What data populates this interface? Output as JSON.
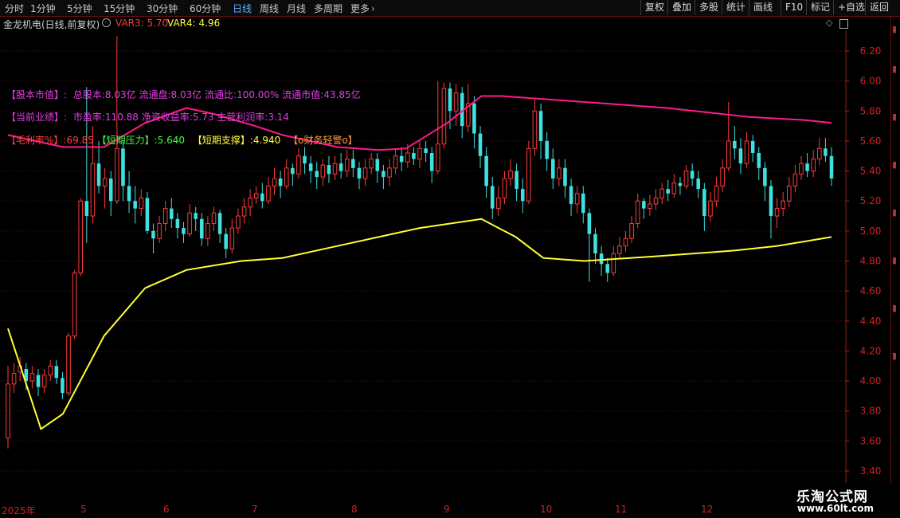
{
  "toolbar": {
    "periods": [
      "分时",
      "1分钟",
      "5分钟",
      "15分钟",
      "30分钟",
      "60分钟",
      "日线",
      "周线",
      "月线",
      "多周期",
      "更多"
    ],
    "active_period": "日线",
    "tools": [
      "复权",
      "叠加",
      "多股",
      "统计",
      "画线",
      "F10",
      "标记",
      "+自选",
      "返回"
    ]
  },
  "stock": {
    "title": "金龙机电(日线,前复权)",
    "var3": "VAR3: 5.70",
    "var4": "VAR4: 4.96"
  },
  "overlay": {
    "line1_label": "【股本市值】:",
    "line1_text": "总股本:8.03亿 流通盘:8.03亿 流通比:100.00% 流通市值:43.85亿",
    "line2_label": "【当前业绩】:",
    "line2_text": "市盈率:110.88 净资收益率:5.73 主营利润率:3.14",
    "line3_a": "【毛利率%】:69.85",
    "line3_b": "【短期压力】:5.640",
    "line3_c": "【短期支撑】:4.940",
    "line3_d": "【o财务轻警o】"
  },
  "price_axis": {
    "ticks": [
      "6.20",
      "6.00",
      "5.80",
      "5.60",
      "5.40",
      "5.20",
      "5.00",
      "4.80",
      "4.60",
      "4.40",
      "4.20",
      "4.00",
      "3.80",
      "3.60",
      "3.40"
    ]
  },
  "date_axis": {
    "labels": [
      "2025年",
      "5",
      "6",
      "7",
      "8",
      "9",
      "10",
      "11",
      "12"
    ]
  },
  "watermark": {
    "line1": "乐淘公式网",
    "line2": "www.60lt.com"
  },
  "colors": {
    "up": "#ff3b3b",
    "down": "#3fe0e0",
    "ma_long": "#ffff33",
    "ma_upper": "#ff1a8c",
    "grid": "#6e1010",
    "label_magenta": "#e040e0",
    "label_red": "#ff4040",
    "label_green": "#40ff40",
    "label_yellow": "#ffff40"
  },
  "chart_data": {
    "type": "candlestick",
    "ylim": [
      3.3,
      6.4
    ],
    "candles": [
      [
        3.62,
        3.98,
        3.55,
        4.1
      ],
      [
        3.98,
        4.05,
        3.92,
        4.12
      ],
      [
        4.06,
        4.1,
        4.0,
        4.16
      ],
      [
        4.08,
        4.0,
        3.94,
        4.12
      ],
      [
        4.0,
        4.05,
        3.95,
        4.1
      ],
      [
        4.04,
        3.96,
        3.9,
        4.08
      ],
      [
        3.96,
        4.04,
        3.92,
        4.08
      ],
      [
        4.04,
        4.1,
        4.0,
        4.14
      ],
      [
        4.1,
        4.02,
        3.98,
        4.14
      ],
      [
        4.02,
        3.92,
        3.88,
        4.06
      ],
      [
        3.92,
        4.3,
        3.9,
        4.32
      ],
      [
        4.3,
        4.72,
        4.28,
        4.74
      ],
      [
        4.72,
        5.2,
        4.7,
        5.22
      ],
      [
        5.2,
        5.1,
        4.92,
        5.96
      ],
      [
        5.1,
        5.45,
        5.05,
        5.7
      ],
      [
        5.45,
        5.3,
        5.25,
        5.6
      ],
      [
        5.3,
        5.35,
        5.15,
        5.42
      ],
      [
        5.35,
        5.2,
        5.1,
        5.4
      ],
      [
        5.2,
        5.55,
        5.18,
        6.3
      ],
      [
        5.55,
        5.3,
        5.2,
        5.6
      ],
      [
        5.3,
        5.2,
        5.12,
        5.4
      ],
      [
        5.2,
        5.15,
        5.05,
        5.3
      ],
      [
        5.15,
        5.22,
        5.1,
        5.28
      ],
      [
        5.22,
        5.0,
        4.98,
        5.26
      ],
      [
        5.0,
        4.95,
        4.85,
        5.05
      ],
      [
        4.95,
        5.05,
        4.92,
        5.1
      ],
      [
        5.05,
        5.15,
        5.0,
        5.2
      ],
      [
        5.15,
        5.08,
        5.02,
        5.22
      ],
      [
        5.08,
        5.02,
        4.95,
        5.12
      ],
      [
        5.02,
        4.98,
        4.92,
        5.06
      ],
      [
        4.98,
        5.12,
        4.96,
        5.18
      ],
      [
        5.12,
        5.08,
        5.0,
        5.16
      ],
      [
        5.08,
        4.95,
        4.9,
        5.12
      ],
      [
        4.95,
        5.05,
        4.9,
        5.1
      ],
      [
        5.05,
        5.12,
        5.0,
        5.16
      ],
      [
        5.12,
        4.98,
        4.92,
        5.14
      ],
      [
        4.98,
        4.88,
        4.82,
        5.02
      ],
      [
        4.88,
        5.02,
        4.85,
        5.08
      ],
      [
        5.02,
        5.1,
        4.98,
        5.15
      ],
      [
        5.1,
        5.16,
        5.05,
        5.22
      ],
      [
        5.16,
        5.22,
        5.1,
        5.28
      ],
      [
        5.22,
        5.25,
        5.18,
        5.3
      ],
      [
        5.25,
        5.2,
        5.15,
        5.32
      ],
      [
        5.2,
        5.3,
        5.18,
        5.36
      ],
      [
        5.3,
        5.35,
        5.24,
        5.42
      ],
      [
        5.35,
        5.3,
        5.22,
        5.4
      ],
      [
        5.3,
        5.42,
        5.28,
        5.48
      ],
      [
        5.42,
        5.38,
        5.3,
        5.45
      ],
      [
        5.38,
        5.5,
        5.35,
        5.55
      ],
      [
        5.5,
        5.45,
        5.38,
        5.56
      ],
      [
        5.45,
        5.4,
        5.32,
        5.5
      ],
      [
        5.4,
        5.36,
        5.28,
        5.46
      ],
      [
        5.36,
        5.44,
        5.3,
        5.48
      ],
      [
        5.44,
        5.38,
        5.32,
        5.5
      ],
      [
        5.38,
        5.45,
        5.34,
        5.5
      ],
      [
        5.45,
        5.4,
        5.35,
        5.52
      ],
      [
        5.4,
        5.48,
        5.36,
        5.54
      ],
      [
        5.48,
        5.42,
        5.36,
        5.54
      ],
      [
        5.42,
        5.35,
        5.28,
        5.46
      ],
      [
        5.35,
        5.42,
        5.3,
        5.48
      ],
      [
        5.42,
        5.48,
        5.38,
        5.52
      ],
      [
        5.48,
        5.4,
        5.32,
        5.52
      ],
      [
        5.4,
        5.36,
        5.28,
        5.44
      ],
      [
        5.36,
        5.42,
        5.3,
        5.48
      ],
      [
        5.42,
        5.5,
        5.38,
        5.55
      ],
      [
        5.5,
        5.46,
        5.4,
        5.56
      ],
      [
        5.46,
        5.52,
        5.42,
        5.58
      ],
      [
        5.52,
        5.48,
        5.44,
        5.56
      ],
      [
        5.48,
        5.55,
        5.42,
        5.6
      ],
      [
        5.55,
        5.52,
        5.46,
        5.6
      ],
      [
        5.52,
        5.4,
        5.32,
        5.56
      ],
      [
        5.4,
        5.58,
        5.38,
        6.0
      ],
      [
        5.58,
        5.95,
        5.55,
        5.99
      ],
      [
        5.95,
        5.8,
        5.68,
        5.99
      ],
      [
        5.8,
        5.92,
        5.7,
        5.98
      ],
      [
        5.92,
        5.7,
        5.62,
        5.96
      ],
      [
        5.7,
        5.85,
        5.66,
        5.98
      ],
      [
        5.85,
        5.65,
        5.55,
        5.9
      ],
      [
        5.65,
        5.5,
        5.42,
        5.7
      ],
      [
        5.5,
        5.3,
        5.22,
        5.56
      ],
      [
        5.3,
        5.15,
        5.08,
        5.36
      ],
      [
        5.15,
        5.22,
        5.1,
        5.3
      ],
      [
        5.22,
        5.35,
        5.18,
        5.4
      ],
      [
        5.35,
        5.4,
        5.3,
        5.48
      ],
      [
        5.4,
        5.28,
        5.2,
        5.45
      ],
      [
        5.28,
        5.2,
        5.12,
        5.35
      ],
      [
        5.2,
        5.55,
        5.18,
        5.6
      ],
      [
        5.55,
        5.8,
        5.5,
        5.88
      ],
      [
        5.8,
        5.6,
        5.48,
        5.85
      ],
      [
        5.6,
        5.48,
        5.4,
        5.66
      ],
      [
        5.48,
        5.35,
        5.28,
        5.55
      ],
      [
        5.35,
        5.42,
        5.3,
        5.48
      ],
      [
        5.42,
        5.3,
        5.22,
        5.48
      ],
      [
        5.3,
        5.18,
        5.1,
        5.35
      ],
      [
        5.18,
        5.25,
        5.12,
        5.3
      ],
      [
        5.25,
        5.12,
        5.05,
        5.3
      ],
      [
        5.12,
        4.98,
        4.66,
        5.15
      ],
      [
        4.98,
        4.85,
        4.78,
        5.02
      ],
      [
        4.85,
        4.78,
        4.7,
        4.9
      ],
      [
        4.78,
        4.72,
        4.66,
        4.82
      ],
      [
        4.72,
        4.85,
        4.7,
        4.9
      ],
      [
        4.85,
        4.9,
        4.82,
        4.96
      ],
      [
        4.9,
        4.95,
        4.86,
        5.0
      ],
      [
        4.95,
        5.05,
        4.92,
        5.1
      ],
      [
        5.05,
        5.2,
        5.02,
        5.25
      ],
      [
        5.2,
        5.15,
        5.08,
        5.22
      ],
      [
        5.15,
        5.18,
        5.1,
        5.24
      ],
      [
        5.18,
        5.22,
        5.14,
        5.28
      ],
      [
        5.22,
        5.28,
        5.18,
        5.32
      ],
      [
        5.28,
        5.25,
        5.2,
        5.34
      ],
      [
        5.25,
        5.32,
        5.22,
        5.38
      ],
      [
        5.32,
        5.3,
        5.24,
        5.36
      ],
      [
        5.3,
        5.4,
        5.28,
        5.44
      ],
      [
        5.4,
        5.35,
        5.3,
        5.45
      ],
      [
        5.35,
        5.28,
        5.22,
        5.4
      ],
      [
        5.28,
        5.1,
        5.0,
        5.32
      ],
      [
        5.1,
        5.2,
        5.06,
        5.26
      ],
      [
        5.2,
        5.3,
        5.16,
        5.36
      ],
      [
        5.3,
        5.42,
        5.26,
        5.48
      ],
      [
        5.42,
        5.6,
        5.4,
        5.86
      ],
      [
        5.6,
        5.55,
        5.48,
        5.7
      ],
      [
        5.55,
        5.45,
        5.38,
        5.62
      ],
      [
        5.45,
        5.6,
        5.42,
        5.66
      ],
      [
        5.6,
        5.52,
        5.46,
        5.64
      ],
      [
        5.52,
        5.42,
        5.34,
        5.56
      ],
      [
        5.42,
        5.3,
        5.2,
        5.46
      ],
      [
        5.3,
        5.1,
        4.95,
        5.34
      ],
      [
        5.1,
        5.15,
        5.02,
        5.22
      ],
      [
        5.15,
        5.2,
        5.1,
        5.26
      ],
      [
        5.2,
        5.3,
        5.16,
        5.36
      ],
      [
        5.3,
        5.38,
        5.26,
        5.44
      ],
      [
        5.38,
        5.45,
        5.34,
        5.5
      ],
      [
        5.45,
        5.4,
        5.36,
        5.52
      ],
      [
        5.4,
        5.48,
        5.36,
        5.54
      ],
      [
        5.48,
        5.55,
        5.44,
        5.62
      ],
      [
        5.55,
        5.5,
        5.46,
        5.62
      ],
      [
        5.5,
        5.35,
        5.3,
        5.56
      ]
    ],
    "ma_long": [
      [
        0,
        4.35
      ],
      [
        24,
        3.68
      ],
      [
        40,
        3.78
      ],
      [
        70,
        4.3
      ],
      [
        100,
        4.62
      ],
      [
        130,
        4.74
      ],
      [
        170,
        4.8
      ],
      [
        200,
        4.82
      ],
      [
        240,
        4.9
      ],
      [
        280,
        4.98
      ],
      [
        300,
        5.02
      ],
      [
        345,
        5.08
      ],
      [
        370,
        4.96
      ],
      [
        390,
        4.82
      ],
      [
        420,
        4.8
      ],
      [
        470,
        4.83
      ],
      [
        530,
        4.87
      ],
      [
        560,
        4.9
      ],
      [
        600,
        4.96
      ]
    ],
    "ma_upper": [
      [
        0,
        5.64
      ],
      [
        40,
        5.56
      ],
      [
        70,
        5.56
      ],
      [
        100,
        5.72
      ],
      [
        130,
        5.82
      ],
      [
        150,
        5.78
      ],
      [
        180,
        5.7
      ],
      [
        200,
        5.64
      ],
      [
        240,
        5.56
      ],
      [
        270,
        5.54
      ],
      [
        290,
        5.55
      ],
      [
        320,
        5.72
      ],
      [
        345,
        5.9
      ],
      [
        360,
        5.9
      ],
      [
        420,
        5.86
      ],
      [
        480,
        5.82
      ],
      [
        540,
        5.76
      ],
      [
        580,
        5.74
      ],
      [
        600,
        5.72
      ]
    ]
  }
}
